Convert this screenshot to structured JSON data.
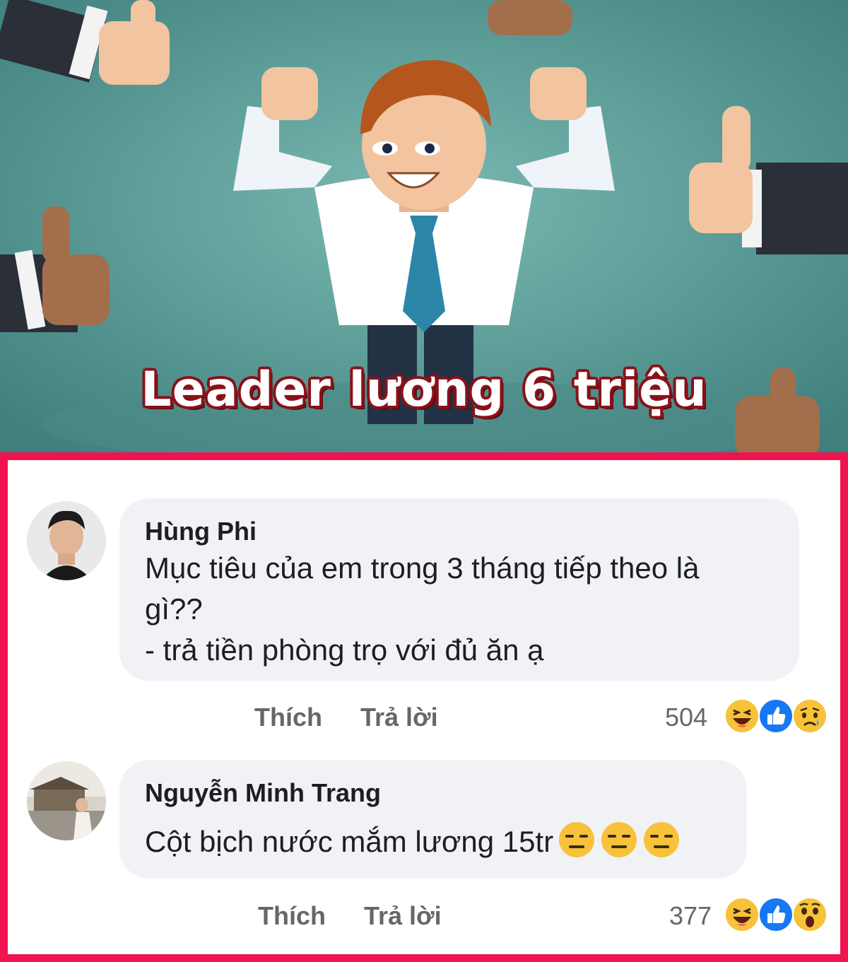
{
  "banner": {
    "title": "Leader lương 6 triệu"
  },
  "comments": [
    {
      "author": "Hùng Phi",
      "text_lines": [
        "Mục tiêu của em trong 3 tháng tiếp theo là",
        "gì??",
        "- trả tiền phòng trọ với đủ ăn ạ"
      ],
      "like_label": "Thích",
      "reply_label": "Trả lời",
      "reaction_count": "504",
      "reactions": [
        "haha-icon",
        "like-icon",
        "sad-icon"
      ]
    },
    {
      "author": "Nguyễn Minh Trang",
      "text": "Cột bịch nước mắm lương 15tr",
      "inline_emojis": [
        "expressionless-face-icon",
        "expressionless-face-icon",
        "expressionless-face-icon"
      ],
      "like_label": "Thích",
      "reply_label": "Trả lời",
      "reaction_count": "377",
      "reactions": [
        "haha-icon",
        "like-icon",
        "wow-icon"
      ]
    }
  ],
  "colors": {
    "panel_border": "#f0134f",
    "bubble_bg": "#f0f2f5",
    "banner_bg": "#5b9c97",
    "title_outline": "#8a1118",
    "like_blue": "#1877f2"
  }
}
